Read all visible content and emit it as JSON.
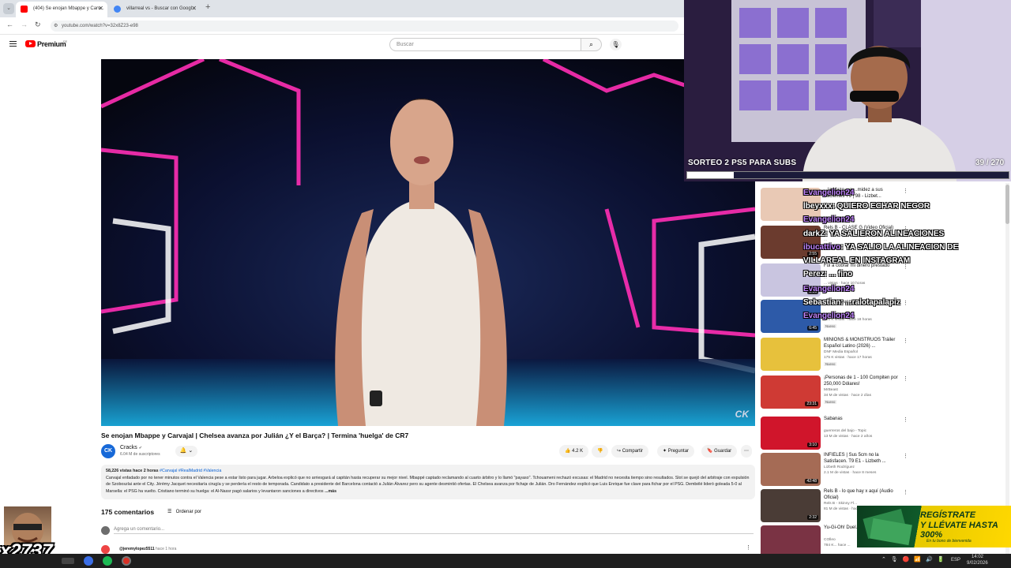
{
  "browser": {
    "tabs": [
      {
        "label": "(404) Se enojan Mbappe y Carv...",
        "active": true,
        "color": "#ff0000"
      },
      {
        "label": "villarreal vs - Buscar con Googl...",
        "active": false,
        "color": "#4285f4"
      }
    ],
    "url": "youtube.com/watch?v=32x8Z23-e98"
  },
  "header": {
    "brand": "Premium",
    "brand_sup": "PE",
    "search_placeholder": "Buscar"
  },
  "video": {
    "title": "Se enojan Mbappe y Carvajal | Chelsea avanza por Julián ¿Y el Barça? | Termina 'huelga' de CR7",
    "watermark": "CK",
    "channel": {
      "name": "Cracks",
      "avatar_text": "CK",
      "subs": "6.04 M de suscriptores"
    },
    "actions": {
      "likes": "4.2 K",
      "share": "Compartir",
      "ask": "Preguntar",
      "save": "Guardar"
    },
    "description": {
      "meta": "58,226 vistas  hace 2 horas",
      "tags": "#Carvajal #RealMadrid #Valencia",
      "text": "Carvajal enfadado por no tener minutos contra el Valencia pese a estar listo para jugar. Arbeloa explicó que no arriesgará al capitán hasta recuperar su mejor nivel. Mbappé captado reclamando al cuarto árbitro y lo llamó \"payaso\". Tchouameni rechazó excusas: el Madrid no necesita tiempo sino resultados. Slot se quejó del arbitraje con expulsión de Szoboszlai ante el City. Jérémy Jacquet necesitaría cirugía y se perdería el resto de temporada. Candidato a presidente del Barcelona contactó a Julián Álvarez pero su agente desmintió ofertas. El Chelsea avanza por fichaje de Julián. Dro Fernández explicó que Luis Enrique fue clave para fichar por el PSG. Dembélé lideró goleada 5-0 al Marsella: el PSG ha vuelto. Cristiano terminó su huelga: el Al-Nassr pagó salarios y levantaron sanciones a directivos",
      "more": "...más"
    }
  },
  "comments": {
    "count": "175 comentarios",
    "sort": "Ordenar por",
    "input_placeholder": "Agrega un comentario...",
    "first_user": "@jeremylopez5511",
    "first_time": "hace 1 hora"
  },
  "stream": {
    "raffle": "SORTEO 2 PS5 PARA SUBS",
    "raffle_count": "39 / 270",
    "raffle_progress": 0.144,
    "combo": "x2737"
  },
  "chat": [
    {
      "user": "Evangelion24",
      "msg": "",
      "x": 0,
      "y": 0
    },
    {
      "user": "",
      "msg": "lbeyxxx: QUIERO ECHAR NEGOR",
      "x": 0,
      "y": 0
    },
    {
      "user": "Evangelion24",
      "msg": "",
      "x": 0,
      "y": 0
    },
    {
      "user": "",
      "msg": "darkZ:  YA SALIERON ALINEACIONES",
      "x": 0,
      "y": 0
    },
    {
      "user": "ibucattivo",
      "msg": ": YA SALIO LA ALINEACION DE",
      "x": 0,
      "y": 0
    },
    {
      "user": "",
      "msg": "VILLAREAL EN INSTAGRAM",
      "x": 0,
      "y": 0
    },
    {
      "user": "",
      "msg": "Perez: ... fino",
      "x": 0,
      "y": 0
    },
    {
      "user": "Evangelion24",
      "msg": "",
      "x": 0,
      "y": 0
    },
    {
      "user": "",
      "msg": "Sebastian: ...ralotapalapiz",
      "x": 0,
      "y": 0
    },
    {
      "user": "Evangelion24",
      "msg": "",
      "x": 0,
      "y": 0
    }
  ],
  "recommendations": [
    {
      "title": "...la Mazo... a ...midez a sus Pacientes T9 | 98 - Lizbet...",
      "channel": "...",
      "views": "945 k vistas · hace 3 semanas",
      "badge": "",
      "dur": "",
      "thumb": "#e9c9b5"
    },
    {
      "title": "Rels B - CLASE G (Video Oficial)",
      "channel": "...",
      "views": "",
      "badge": "",
      "dur": "2:55",
      "thumb": "#6b3b2e"
    },
    {
      "title": "Fui a cobrar mi dinero prestado",
      "channel": "...",
      "views": "... vistas · hace 10 horas",
      "badge": "Nuevo",
      "dur": "1:16",
      "thumb": "#c9c5e0"
    },
    {
      "title": "| Barça invencible en casa | ...",
      "channel": "...",
      "views": "206 K vistas · hace 18 horas",
      "badge": "Nuevo",
      "dur": "6:45",
      "thumb": "#2d5aa8"
    },
    {
      "title": "MINIONS & MONSTRUOS Tráiler Español Latino (2026) ...",
      "channel": "DNF Media Español",
      "views": "175 K vistas · hace 17 horas",
      "badge": "Nuevo",
      "dur": "",
      "thumb": "#e7c13c"
    },
    {
      "title": "¡Personas de 1 - 100 Compiten por 250,000 Dólares!",
      "channel": "MrBeast",
      "views": "34 M de vistas · hace 2 días",
      "badge": "Nuevo",
      "dur": "23:31",
      "thumb": "#cf3a34"
    },
    {
      "title": "Sabanas",
      "channel": "guerreros del bajo - Topic",
      "views": "13 M de vistas · hace 2 años",
      "badge": "",
      "dur": "3:10",
      "thumb": "#d0152b"
    },
    {
      "title": "INFIELES | Sus 5cm no la Satisfacen. T9 E1 - Lizbeth ...",
      "channel": "Lizbeth Rodríguez",
      "views": "2.1 M de vistas · hace 8 meses",
      "badge": "",
      "dur": "42:48",
      "thumb": "#a56b55"
    },
    {
      "title": "Rels B - lo que hay x aquí (Audio Oficial)",
      "channel": "Rels B - Skinny Fl...",
      "views": "81 M de vistas · hace ...",
      "badge": "",
      "dur": "2:32",
      "thumb": "#4a3c36"
    },
    {
      "title": "Yu-Gi-Oh! Duel... Español",
      "channel": "COlleo",
      "views": "784 K... hace ...",
      "badge": "",
      "dur": "",
      "thumb": "#7a3344"
    }
  ],
  "ad": {
    "line1": "REGÍSTRATE",
    "line2": "Y LLÉVATE HASTA 300%",
    "line3": "En tu bono de bienvenida"
  },
  "taskbar": {
    "lang": "ESP",
    "time": "14:02",
    "date": "9/02/2026"
  }
}
